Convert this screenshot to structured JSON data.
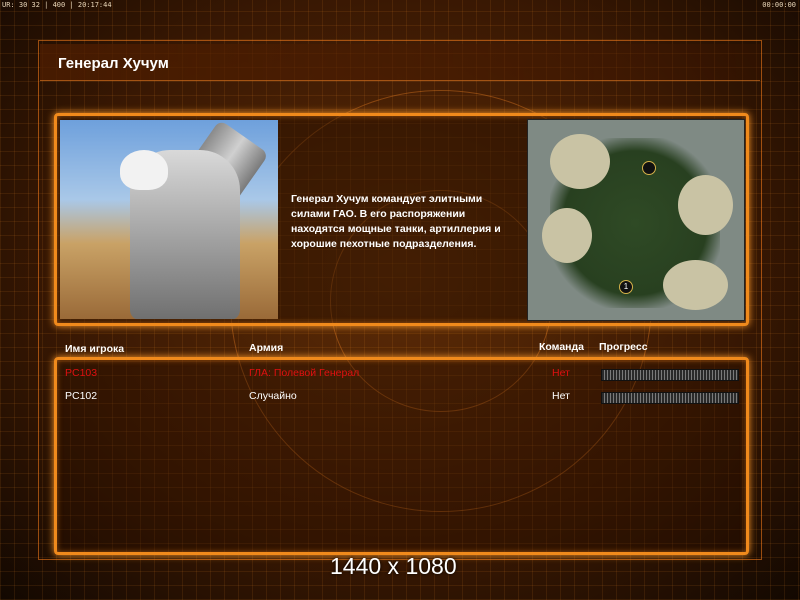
{
  "hud": {
    "left": "UR: 30 32 | 400 | 20:17:44",
    "right": "00:00:00"
  },
  "title": "Генерал Хучум",
  "description": "Генерал Хучум командует элитными силами ГАО. В его распоряжении находятся мощные танки, артиллерия и хорошие пехотные подразделения.",
  "minimap": {
    "markers": [
      "",
      "1"
    ]
  },
  "columns": {
    "player": "Имя игрока",
    "army": "Армия",
    "team": "Команда",
    "progress": "Прогресс"
  },
  "players": [
    {
      "name": "PC103",
      "army": "ГЛА: Полевой Генерал",
      "team": "Нет",
      "color": "#e01010",
      "progress": 1.0
    },
    {
      "name": "PC102",
      "army": "Случайно",
      "team": "Нет",
      "color": "#ffffff",
      "progress": 1.0
    }
  ],
  "resolution": "1440 x 1080",
  "colors": {
    "accent": "#f08a1c",
    "highlight_player": "#e01010"
  }
}
